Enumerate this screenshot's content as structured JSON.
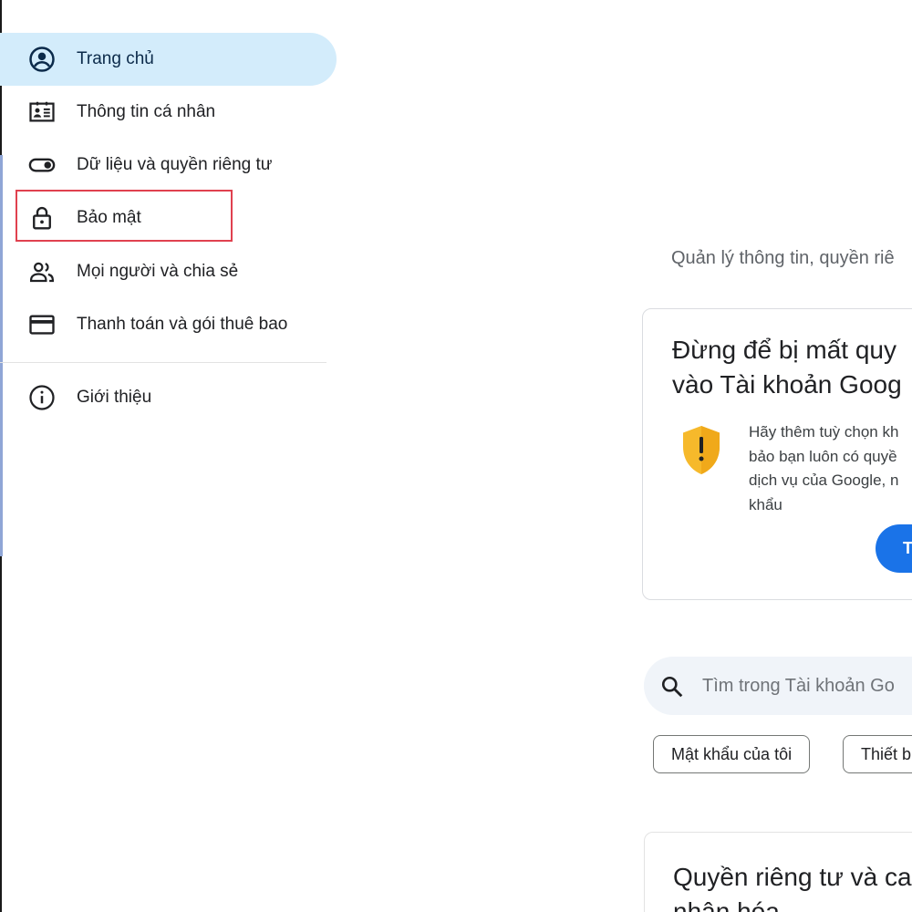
{
  "sidebar": {
    "items": [
      {
        "label": "Trang chủ",
        "icon": "account-circle-icon",
        "active": true
      },
      {
        "label": "Thông tin cá nhân",
        "icon": "id-card-icon"
      },
      {
        "label": "Dữ liệu và quyền riêng tư",
        "icon": "toggle-icon"
      },
      {
        "label": "Bảo mật",
        "icon": "lock-icon"
      },
      {
        "label": "Mọi người và chia sẻ",
        "icon": "people-icon"
      },
      {
        "label": "Thanh toán và gói thuê bao",
        "icon": "credit-card-icon"
      },
      {
        "label": "Giới thiệu",
        "icon": "info-icon"
      }
    ]
  },
  "colors": {
    "active_bg": "#d3ecfb",
    "highlight": "#e0414f",
    "primary": "#1a73e8",
    "shield": "#f6b92b"
  },
  "main": {
    "subtitle": "Quản lý thông tin, quyền riê",
    "alert_card": {
      "title_lines": [
        "Đừng để bị mất quy",
        "vào Tài khoản Goog"
      ],
      "icon": "warning-shield-icon",
      "body_lines": [
        "Hãy thêm tuỳ chọn kh",
        "bảo bạn luôn có quyề",
        "dịch vụ của Google, n",
        "khẩu"
      ],
      "button_label": "T"
    },
    "search": {
      "placeholder": "Tìm trong Tài khoản Go"
    },
    "chips": [
      "Mật khẩu của tôi",
      "Thiết b"
    ],
    "privacy_card": {
      "title_lines": [
        "Quyền riêng tư và ca",
        "nhân hóa"
      ]
    }
  }
}
